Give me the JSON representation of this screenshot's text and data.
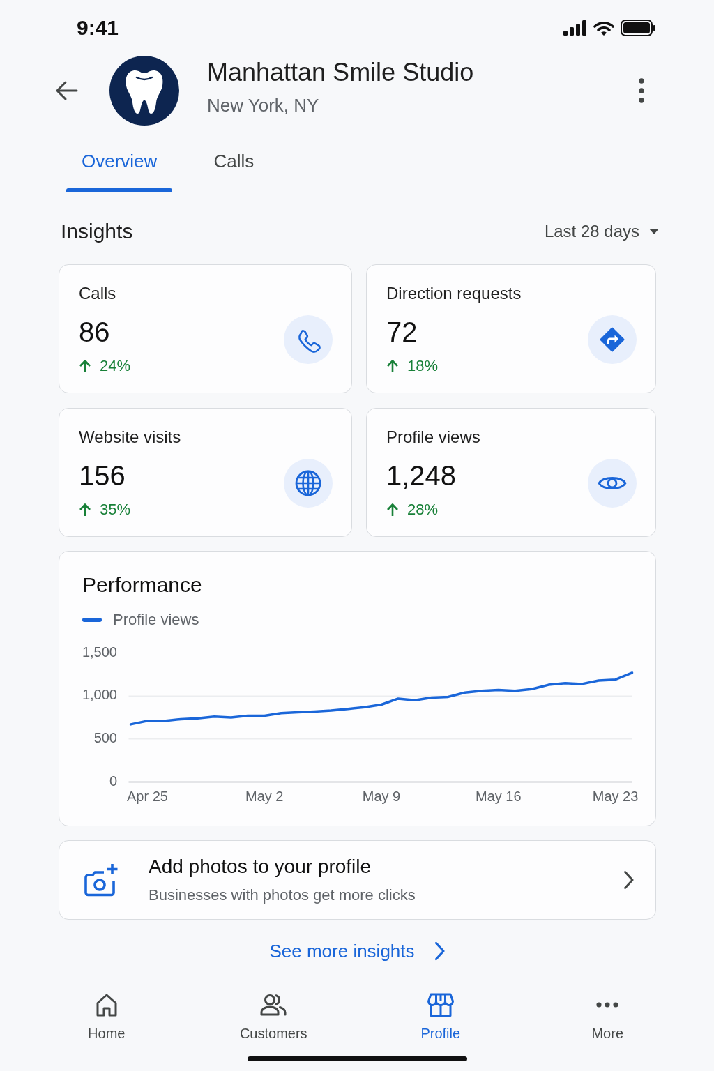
{
  "status_bar": {
    "time": "9:41"
  },
  "header": {
    "title": "Manhattan Smile Studio",
    "subtitle": "New York, NY"
  },
  "tabs": [
    {
      "label": "Overview",
      "selected": true
    },
    {
      "label": "Calls",
      "selected": false
    }
  ],
  "insights": {
    "title": "Insights",
    "date_range": "Last 28 days",
    "metrics": [
      {
        "kind": "phone",
        "label": "Calls",
        "value": "86",
        "change": "24%"
      },
      {
        "kind": "directions",
        "label": "Direction requests",
        "value": "72",
        "change": "18%"
      },
      {
        "kind": "globe",
        "label": "Website visits",
        "value": "156",
        "change": "35%"
      },
      {
        "kind": "eye",
        "label": "Profile views",
        "value": "1,248",
        "change": "28%"
      }
    ]
  },
  "performance": {
    "title": "Performance",
    "chart_data": {
      "type": "line",
      "categories": [
        null,
        "Apr 25",
        null,
        null,
        null,
        null,
        null,
        null,
        "May 2",
        null,
        null,
        null,
        null,
        null,
        null,
        "May 9",
        null,
        null,
        null,
        null,
        null,
        null,
        "May 16",
        null,
        null,
        null,
        null,
        null,
        null,
        "May 23",
        null
      ],
      "ylim": [
        0,
        1500
      ],
      "yticks": [
        {
          "value": 0,
          "label": "0"
        },
        {
          "value": 500,
          "label": "500"
        },
        {
          "value": 1000,
          "label": "1,000"
        },
        {
          "value": 1500,
          "label": "1,500"
        }
      ],
      "series": [
        {
          "name": "Profile views",
          "color": "#1a66d9",
          "values": [
            670,
            710,
            710,
            730,
            740,
            760,
            750,
            770,
            770,
            800,
            810,
            820,
            830,
            850,
            870,
            900,
            970,
            950,
            980,
            990,
            1040,
            1060,
            1070,
            1060,
            1080,
            1130,
            1150,
            1140,
            1180,
            1190,
            1270
          ]
        }
      ]
    }
  },
  "promo": {
    "title": "Add photos to your profile",
    "subtitle": "Businesses with photos get more clicks"
  },
  "see_more": {
    "label": "See more insights"
  },
  "bottom_nav": [
    {
      "kind": "home",
      "label": "Home",
      "selected": false
    },
    {
      "kind": "people",
      "label": "Customers",
      "selected": false
    },
    {
      "kind": "store",
      "label": "Profile",
      "selected": true
    },
    {
      "kind": "more",
      "label": "More",
      "selected": false
    }
  ]
}
